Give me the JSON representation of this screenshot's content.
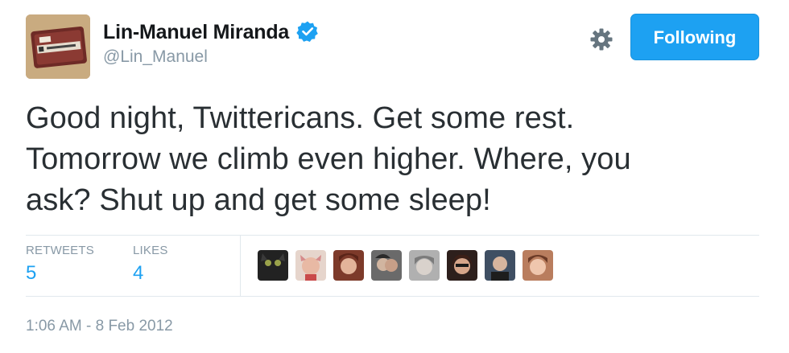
{
  "author": {
    "display_name": "Lin-Manuel Miranda",
    "handle": "@Lin_Manuel",
    "verified": true,
    "avatar_icon": "name-badge-avatar"
  },
  "actions": {
    "follow_label": "Following",
    "settings_icon": "gear-icon"
  },
  "tweet": {
    "line_1": "Good night, Twittericans. Get some rest.",
    "line_2": "Tomorrow we climb even higher. Where, you",
    "line_3": "ask? Shut up and get some sleep!"
  },
  "stats": {
    "retweets_label": "RETWEETS",
    "retweets_value": "5",
    "likes_label": "LIKES",
    "likes_value": "4"
  },
  "likers": [
    {
      "name": "liker-avatar-1",
      "color": "#2b2b2b"
    },
    {
      "name": "liker-avatar-2",
      "color": "#d9b3a5"
    },
    {
      "name": "liker-avatar-3",
      "color": "#a0523c"
    },
    {
      "name": "liker-avatar-4",
      "color": "#4a4a4a"
    },
    {
      "name": "liker-avatar-5",
      "color": "#8f8f8f"
    },
    {
      "name": "liker-avatar-6",
      "color": "#3d2a25"
    },
    {
      "name": "liker-avatar-7",
      "color": "#5b6470"
    },
    {
      "name": "liker-avatar-8",
      "color": "#c08a6e"
    }
  ],
  "meta": {
    "timestamp": "1:06 AM - 8 Feb 2012"
  },
  "colors": {
    "accent": "#1da1f2",
    "muted": "#8899a6",
    "text": "#292f33",
    "divider": "#e1e8ed"
  }
}
